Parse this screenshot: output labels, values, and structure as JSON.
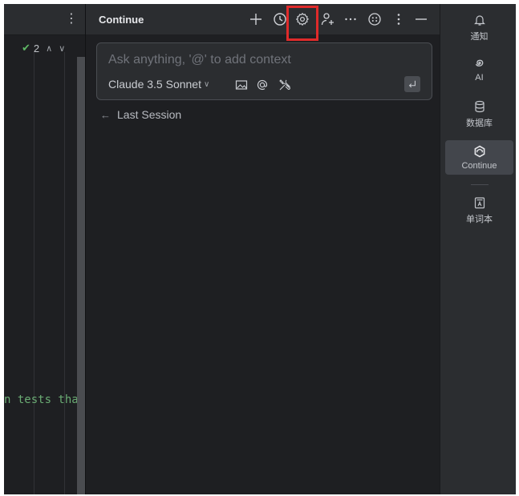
{
  "editor": {
    "inspection_count": "2",
    "code_fragment": "n tests tha"
  },
  "panel": {
    "title": "Continue",
    "toolbar_icons": [
      "plus-icon",
      "history-icon",
      "gear-icon",
      "add-user-icon",
      "ellipsis-icon",
      "emoji-icon",
      "kebab-icon",
      "minimize-icon"
    ],
    "input": {
      "placeholder": "Ask anything, '@' to add context",
      "model": "Claude 3.5 Sonnet"
    },
    "last_session": "Last Session"
  },
  "rightbar": {
    "items": [
      {
        "label": "通知",
        "icon": "bell-icon"
      },
      {
        "label": "AI",
        "icon": "ai-spiral-icon"
      },
      {
        "label": "数据库",
        "icon": "database-icon"
      },
      {
        "label": "Continue",
        "icon": "continue-icon",
        "active": true
      },
      {
        "label": "单词本",
        "icon": "wordbook-icon"
      }
    ]
  },
  "colors": {
    "highlight": "#e02a2a",
    "code_string": "#6aab73",
    "check": "#5fb865"
  }
}
